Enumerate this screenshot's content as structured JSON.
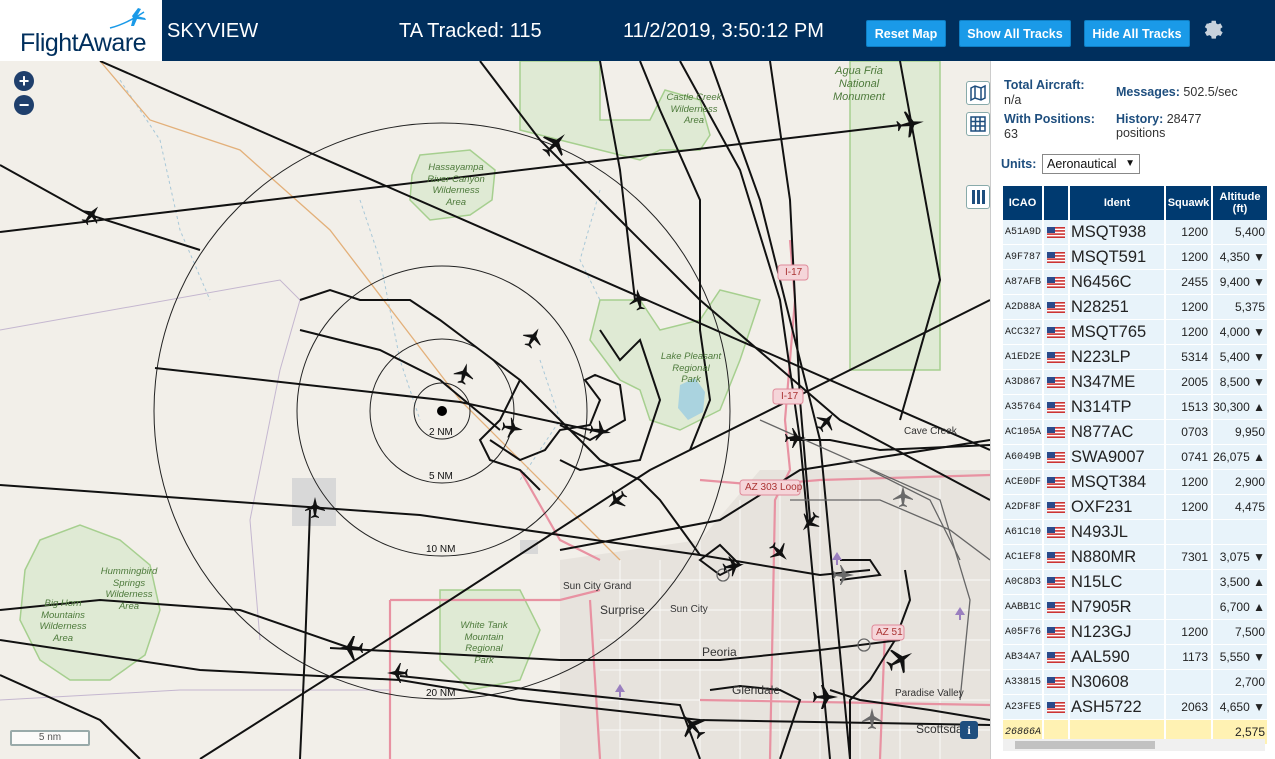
{
  "header": {
    "logo": "FlightAware",
    "title": "SKYVIEW",
    "tracked": "TA Tracked: 115",
    "datetime": "11/2/2019, 3:50:12 PM",
    "buttons": {
      "reset": "Reset Map",
      "show_all": "Show All Tracks",
      "hide_all": "Hide All Tracks"
    },
    "settings_icon": "gear-icon"
  },
  "map": {
    "zoom_in": "+",
    "zoom_out": "−",
    "scale": "5 nm",
    "range_rings": [
      "2 NM",
      "5 NM",
      "10 NM",
      "20 NM"
    ],
    "places": {
      "agua_fria": [
        "Agua Fria",
        "National",
        "Monument"
      ],
      "castle_creek": [
        "Castle Creek",
        "Wilderness",
        "Area"
      ],
      "hassayampa": [
        "Hassayampa",
        "River Canyon",
        "Wilderness",
        "Area"
      ],
      "lake_pleasant": [
        "Lake Pleasant",
        "Regional",
        "Park"
      ],
      "hummingbird": [
        "Hummingbird",
        "Springs",
        "Wilderness",
        "Area"
      ],
      "big_horn": [
        "Big Horn",
        "Mountains",
        "Wilderness",
        "Area"
      ],
      "white_tank": [
        "White Tank",
        "Mountain",
        "Regional",
        "Park"
      ],
      "cave_creek": "Cave Creek",
      "sun_city_grand": "Sun City Grand",
      "surprise": "Surprise",
      "sun_city": "Sun City",
      "peoria": "Peoria",
      "glendale": "Glendale",
      "paradise_valley": "Paradise Valley",
      "scottsdale": "Scottsdale"
    },
    "roads": {
      "i17a": "I-17",
      "i17b": "I-17",
      "az303": "AZ 303 Loop",
      "az51": "AZ 51"
    }
  },
  "panel": {
    "total_aircraft_label": "Total Aircraft:",
    "total_aircraft_value": "n/a",
    "with_positions_label": "With Positions:",
    "with_positions_value": "63",
    "messages_label": "Messages:",
    "messages_value": "502.5/sec",
    "history_label": "History:",
    "history_value": "28477",
    "history_unit": "positions",
    "units_label": "Units:",
    "units_value": "Aeronautical",
    "columns": {
      "icao": "ICAO",
      "flag": "",
      "ident": "Ident",
      "squawk": "Squawk",
      "altitude": "Altitude (ft)"
    },
    "rows": [
      {
        "icao": "A51A9D",
        "ident": "MSQT938",
        "squawk": "1200",
        "alt": "5,400"
      },
      {
        "icao": "A9F787",
        "ident": "MSQT591",
        "squawk": "1200",
        "alt": "4,350 ▼"
      },
      {
        "icao": "A87AFB",
        "ident": "N6456C",
        "squawk": "2455",
        "alt": "9,400 ▼"
      },
      {
        "icao": "A2D88A",
        "ident": "N28251",
        "squawk": "1200",
        "alt": "5,375"
      },
      {
        "icao": "ACC327",
        "ident": "MSQT765",
        "squawk": "1200",
        "alt": "4,000 ▼"
      },
      {
        "icao": "A1ED2E",
        "ident": "N223LP",
        "squawk": "5314",
        "alt": "5,400 ▼"
      },
      {
        "icao": "A3D867",
        "ident": "N347ME",
        "squawk": "2005",
        "alt": "8,500 ▼"
      },
      {
        "icao": "A35764",
        "ident": "N314TP",
        "squawk": "1513",
        "alt": "30,300 ▲"
      },
      {
        "icao": "AC105A",
        "ident": "N877AC",
        "squawk": "0703",
        "alt": "9,950"
      },
      {
        "icao": "A6049B",
        "ident": "SWA9007",
        "squawk": "0741",
        "alt": "26,075 ▲"
      },
      {
        "icao": "ACE0DF",
        "ident": "MSQT384",
        "squawk": "1200",
        "alt": "2,900"
      },
      {
        "icao": "A2DF8F",
        "ident": "OXF231",
        "squawk": "1200",
        "alt": "4,475"
      },
      {
        "icao": "A61C10",
        "ident": "N493JL",
        "squawk": "",
        "alt": ""
      },
      {
        "icao": "AC1EF8",
        "ident": "N880MR",
        "squawk": "7301",
        "alt": "3,075 ▼"
      },
      {
        "icao": "A0C8D3",
        "ident": "N15LC",
        "squawk": "",
        "alt": "3,500 ▲"
      },
      {
        "icao": "AABB1C",
        "ident": "N7905R",
        "squawk": "",
        "alt": "6,700 ▲"
      },
      {
        "icao": "A05F76",
        "ident": "N123GJ",
        "squawk": "1200",
        "alt": "7,500"
      },
      {
        "icao": "AB34A7",
        "ident": "AAL590",
        "squawk": "1173",
        "alt": "5,550 ▼"
      },
      {
        "icao": "A33815",
        "ident": "N30608",
        "squawk": "",
        "alt": "2,700"
      },
      {
        "icao": "A23FE5",
        "ident": "ASH5722",
        "squawk": "2063",
        "alt": "4,650 ▼"
      },
      {
        "icao": "26866A",
        "ident": "",
        "squawk": "",
        "alt": "2,575",
        "selected": true
      }
    ]
  },
  "colors": {
    "header_bg": "#002f5d",
    "button_bg": "#1a9ae8",
    "table_header": "#003a70",
    "row_bg": "#e8f3fa",
    "selected_row": "#fff2b3",
    "map_bg": "#f2efe9"
  }
}
